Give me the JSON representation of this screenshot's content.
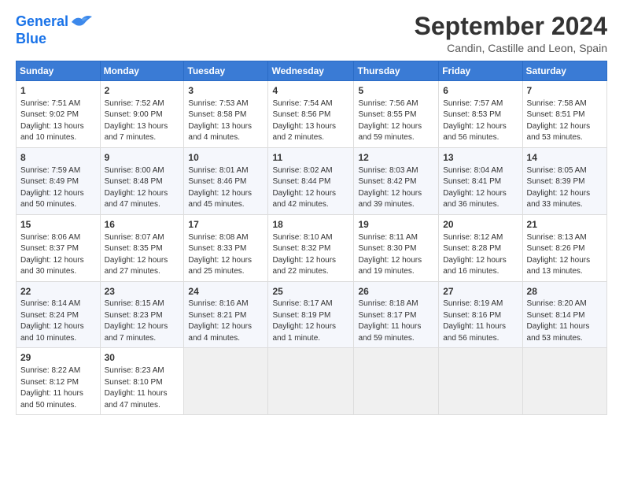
{
  "logo": {
    "line1": "General",
    "line2": "Blue"
  },
  "title": "September 2024",
  "location": "Candin, Castille and Leon, Spain",
  "days_header": [
    "Sunday",
    "Monday",
    "Tuesday",
    "Wednesday",
    "Thursday",
    "Friday",
    "Saturday"
  ],
  "weeks": [
    [
      {
        "day": 1,
        "info": "Sunrise: 7:51 AM\nSunset: 9:02 PM\nDaylight: 13 hours\nand 10 minutes."
      },
      {
        "day": 2,
        "info": "Sunrise: 7:52 AM\nSunset: 9:00 PM\nDaylight: 13 hours\nand 7 minutes."
      },
      {
        "day": 3,
        "info": "Sunrise: 7:53 AM\nSunset: 8:58 PM\nDaylight: 13 hours\nand 4 minutes."
      },
      {
        "day": 4,
        "info": "Sunrise: 7:54 AM\nSunset: 8:56 PM\nDaylight: 13 hours\nand 2 minutes."
      },
      {
        "day": 5,
        "info": "Sunrise: 7:56 AM\nSunset: 8:55 PM\nDaylight: 12 hours\nand 59 minutes."
      },
      {
        "day": 6,
        "info": "Sunrise: 7:57 AM\nSunset: 8:53 PM\nDaylight: 12 hours\nand 56 minutes."
      },
      {
        "day": 7,
        "info": "Sunrise: 7:58 AM\nSunset: 8:51 PM\nDaylight: 12 hours\nand 53 minutes."
      }
    ],
    [
      {
        "day": 8,
        "info": "Sunrise: 7:59 AM\nSunset: 8:49 PM\nDaylight: 12 hours\nand 50 minutes."
      },
      {
        "day": 9,
        "info": "Sunrise: 8:00 AM\nSunset: 8:48 PM\nDaylight: 12 hours\nand 47 minutes."
      },
      {
        "day": 10,
        "info": "Sunrise: 8:01 AM\nSunset: 8:46 PM\nDaylight: 12 hours\nand 45 minutes."
      },
      {
        "day": 11,
        "info": "Sunrise: 8:02 AM\nSunset: 8:44 PM\nDaylight: 12 hours\nand 42 minutes."
      },
      {
        "day": 12,
        "info": "Sunrise: 8:03 AM\nSunset: 8:42 PM\nDaylight: 12 hours\nand 39 minutes."
      },
      {
        "day": 13,
        "info": "Sunrise: 8:04 AM\nSunset: 8:41 PM\nDaylight: 12 hours\nand 36 minutes."
      },
      {
        "day": 14,
        "info": "Sunrise: 8:05 AM\nSunset: 8:39 PM\nDaylight: 12 hours\nand 33 minutes."
      }
    ],
    [
      {
        "day": 15,
        "info": "Sunrise: 8:06 AM\nSunset: 8:37 PM\nDaylight: 12 hours\nand 30 minutes."
      },
      {
        "day": 16,
        "info": "Sunrise: 8:07 AM\nSunset: 8:35 PM\nDaylight: 12 hours\nand 27 minutes."
      },
      {
        "day": 17,
        "info": "Sunrise: 8:08 AM\nSunset: 8:33 PM\nDaylight: 12 hours\nand 25 minutes."
      },
      {
        "day": 18,
        "info": "Sunrise: 8:10 AM\nSunset: 8:32 PM\nDaylight: 12 hours\nand 22 minutes."
      },
      {
        "day": 19,
        "info": "Sunrise: 8:11 AM\nSunset: 8:30 PM\nDaylight: 12 hours\nand 19 minutes."
      },
      {
        "day": 20,
        "info": "Sunrise: 8:12 AM\nSunset: 8:28 PM\nDaylight: 12 hours\nand 16 minutes."
      },
      {
        "day": 21,
        "info": "Sunrise: 8:13 AM\nSunset: 8:26 PM\nDaylight: 12 hours\nand 13 minutes."
      }
    ],
    [
      {
        "day": 22,
        "info": "Sunrise: 8:14 AM\nSunset: 8:24 PM\nDaylight: 12 hours\nand 10 minutes."
      },
      {
        "day": 23,
        "info": "Sunrise: 8:15 AM\nSunset: 8:23 PM\nDaylight: 12 hours\nand 7 minutes."
      },
      {
        "day": 24,
        "info": "Sunrise: 8:16 AM\nSunset: 8:21 PM\nDaylight: 12 hours\nand 4 minutes."
      },
      {
        "day": 25,
        "info": "Sunrise: 8:17 AM\nSunset: 8:19 PM\nDaylight: 12 hours\nand 1 minute."
      },
      {
        "day": 26,
        "info": "Sunrise: 8:18 AM\nSunset: 8:17 PM\nDaylight: 11 hours\nand 59 minutes."
      },
      {
        "day": 27,
        "info": "Sunrise: 8:19 AM\nSunset: 8:16 PM\nDaylight: 11 hours\nand 56 minutes."
      },
      {
        "day": 28,
        "info": "Sunrise: 8:20 AM\nSunset: 8:14 PM\nDaylight: 11 hours\nand 53 minutes."
      }
    ],
    [
      {
        "day": 29,
        "info": "Sunrise: 8:22 AM\nSunset: 8:12 PM\nDaylight: 11 hours\nand 50 minutes."
      },
      {
        "day": 30,
        "info": "Sunrise: 8:23 AM\nSunset: 8:10 PM\nDaylight: 11 hours\nand 47 minutes."
      },
      null,
      null,
      null,
      null,
      null
    ]
  ]
}
